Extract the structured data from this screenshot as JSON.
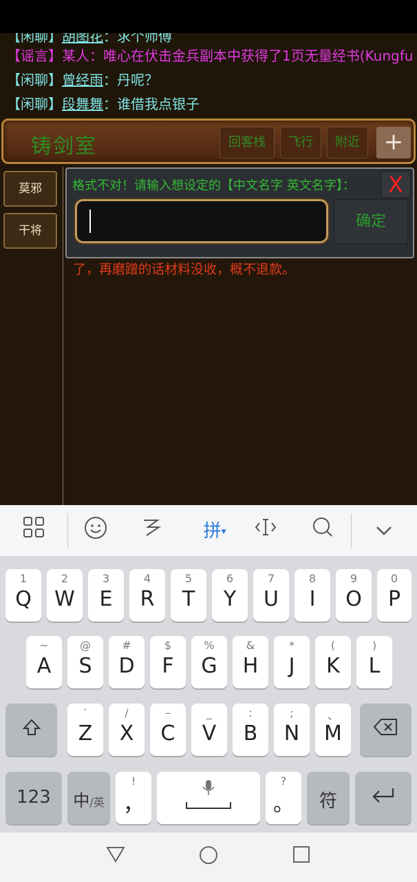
{
  "chat": [
    {
      "tag": "【闲聊】",
      "user": "胡图花",
      "msg": "：求个师傅",
      "type": "chat"
    },
    {
      "tag": "【谣言】",
      "user": "某人",
      "msg": "：唯心在伏击金兵副本中获得了1页无量经书(Kungfu",
      "type": "rumor"
    },
    {
      "tag": "【闲聊】",
      "user": "曾经雨",
      "msg": "：丹呢？",
      "type": "chat"
    },
    {
      "tag": "【闲聊】",
      "user": "段舞舞",
      "msg": "：谁借我点银子",
      "type": "chat"
    }
  ],
  "room": {
    "title": "铸剑室",
    "buttons": [
      "回客栈",
      "飞行",
      "附近"
    ],
    "plus": "+"
  },
  "sidebar": [
    "莫邪",
    "干将"
  ],
  "dialog": {
    "message": "格式不对！请输入想设定的【中文名字 英文名字】：",
    "close": "X",
    "input_value": "",
    "ok": "确定"
  },
  "under_text": "了，再磨蹭的话材料没收，概不退款。",
  "keyboard": {
    "toolbar": {
      "pinyin": "拼"
    },
    "row1": [
      {
        "k": "Q",
        "h": "1"
      },
      {
        "k": "W",
        "h": "2"
      },
      {
        "k": "E",
        "h": "3"
      },
      {
        "k": "R",
        "h": "4"
      },
      {
        "k": "T",
        "h": "5"
      },
      {
        "k": "Y",
        "h": "6"
      },
      {
        "k": "U",
        "h": "7"
      },
      {
        "k": "I",
        "h": "8"
      },
      {
        "k": "O",
        "h": "9"
      },
      {
        "k": "P",
        "h": "0"
      }
    ],
    "row2": [
      {
        "k": "A",
        "h": "~"
      },
      {
        "k": "S",
        "h": "@"
      },
      {
        "k": "D",
        "h": "#"
      },
      {
        "k": "F",
        "h": "$"
      },
      {
        "k": "G",
        "h": "%"
      },
      {
        "k": "H",
        "h": "&"
      },
      {
        "k": "J",
        "h": "*"
      },
      {
        "k": "K",
        "h": "("
      },
      {
        "k": "L",
        "h": ")"
      }
    ],
    "row3": [
      {
        "k": "Z",
        "h": "′"
      },
      {
        "k": "X",
        "h": "/"
      },
      {
        "k": "C",
        "h": "–"
      },
      {
        "k": "V",
        "h": "_"
      },
      {
        "k": "B",
        "h": ":"
      },
      {
        "k": "N",
        "h": ";"
      },
      {
        "k": "M",
        "h": "、"
      }
    ],
    "num": "123",
    "lang_main": "中",
    "lang_sub": "/英",
    "comma": "，",
    "comma_hint": "!",
    "period": "。",
    "period_hint": "?",
    "symbol": "符"
  }
}
